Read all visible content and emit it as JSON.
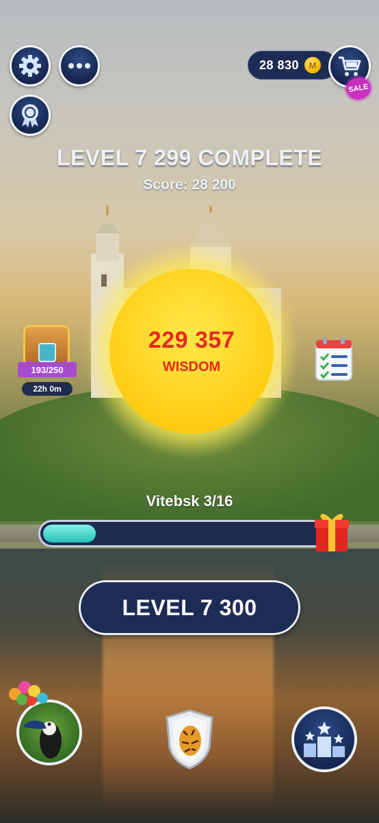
{
  "header": {
    "coins": "28 830",
    "coin_icon": "coin-icon",
    "sale_badge": "SALE"
  },
  "result": {
    "title": "LEVEL 7 299 COMPLETE",
    "score": "Score: 28 200"
  },
  "wisdom": {
    "value": "229 357",
    "label": "WISDOM"
  },
  "chest": {
    "progress": "193/250",
    "timer": "22h 0m"
  },
  "city_progress": {
    "label": "Vitebsk 3/16",
    "fraction": 0.1875
  },
  "play": {
    "label": "LEVEL 7 300"
  },
  "colors": {
    "accent_navy": "#1d2c55",
    "wisdom_red": "#e6281e",
    "progress_teal": "#3cd3c6",
    "sale_magenta": "#c82fbf"
  }
}
